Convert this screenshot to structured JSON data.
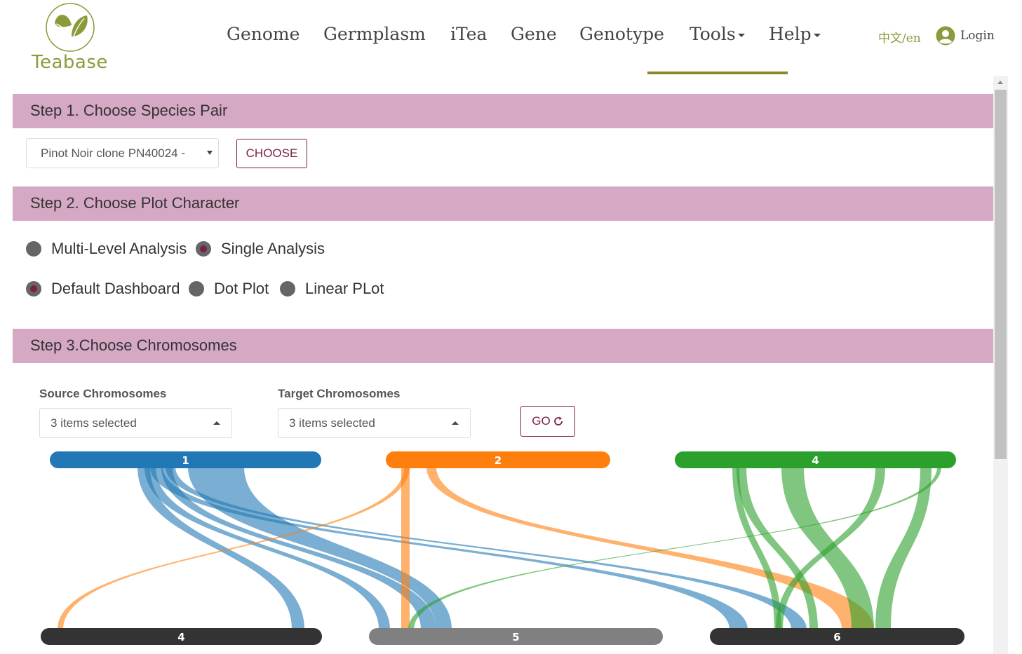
{
  "brand": {
    "name": "Teabase"
  },
  "nav": {
    "items": [
      {
        "label": "Genome",
        "dropdown": false
      },
      {
        "label": "Germplasm",
        "dropdown": false
      },
      {
        "label": "iTea",
        "dropdown": false
      },
      {
        "label": "Gene",
        "dropdown": false
      },
      {
        "label": "Genotype",
        "dropdown": false
      },
      {
        "label": "Tools",
        "dropdown": true
      },
      {
        "label": "Help",
        "dropdown": true
      }
    ],
    "active": "Tools",
    "lang": "中文/en",
    "login": "Login"
  },
  "step1": {
    "title": "Step 1. Choose Species Pair",
    "species_value": "Pinot Noir clone PN40024 -",
    "choose_button": "CHOOSE"
  },
  "step2": {
    "title": "Step 2. Choose Plot Character",
    "analysis_options": [
      {
        "label": "Multi-Level Analysis",
        "checked": false
      },
      {
        "label": "Single Analysis",
        "checked": true
      }
    ],
    "plot_options": [
      {
        "label": "Default Dashboard",
        "checked": true
      },
      {
        "label": "Dot Plot",
        "checked": false
      },
      {
        "label": "Linear PLot",
        "checked": false
      }
    ]
  },
  "step3": {
    "title": "Step 3.Choose Chromosomes",
    "source_label": "Source Chromosomes",
    "source_value": "3 items selected",
    "target_label": "Target Chromosomes",
    "target_value": "3 items selected",
    "go_button": "GO"
  },
  "colors": {
    "accent": "#7a1f4a",
    "step_bar": "#d5a8c4",
    "brand": "#8b9a3a",
    "chr1": "#2178b4",
    "chr2": "#ff7f0e",
    "chr4_source": "#2ca02c",
    "target_dark": "#333333",
    "target_grey": "#808080"
  },
  "chart_data": {
    "type": "synteny",
    "source_chromosomes": [
      {
        "name": "1",
        "color": "#2178b4"
      },
      {
        "name": "2",
        "color": "#ff7f0e"
      },
      {
        "name": "4",
        "color": "#2ca02c"
      }
    ],
    "target_chromosomes": [
      {
        "name": "4",
        "color": "#333333"
      },
      {
        "name": "5",
        "color": "#808080"
      },
      {
        "name": "6",
        "color": "#333333"
      }
    ],
    "links": [
      {
        "source": "1",
        "target": "4"
      },
      {
        "source": "1",
        "target": "5"
      },
      {
        "source": "1",
        "target": "5"
      },
      {
        "source": "1",
        "target": "5"
      },
      {
        "source": "1",
        "target": "6"
      },
      {
        "source": "1",
        "target": "6"
      },
      {
        "source": "2",
        "target": "4"
      },
      {
        "source": "2",
        "target": "5"
      },
      {
        "source": "2",
        "target": "6"
      },
      {
        "source": "4",
        "target": "5"
      },
      {
        "source": "4",
        "target": "6"
      },
      {
        "source": "4",
        "target": "6"
      },
      {
        "source": "4",
        "target": "6"
      },
      {
        "source": "4",
        "target": "6"
      },
      {
        "source": "4",
        "target": "6"
      }
    ]
  }
}
